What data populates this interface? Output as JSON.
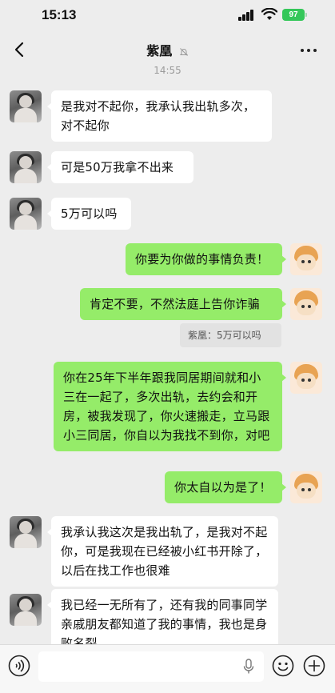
{
  "status_bar": {
    "time": "15:13",
    "battery": "97"
  },
  "header": {
    "title": "紫凰",
    "back_icon": "chevron-left-icon",
    "mute_icon": "bell-slash-icon",
    "more_icon": "more-dots-icon"
  },
  "chat": {
    "timestamp": "14:55",
    "messages": [
      {
        "side": "left",
        "text": "是我对不起你，我承认我出轨多次，对不起你"
      },
      {
        "side": "left",
        "text": "可是50万我拿不出来"
      },
      {
        "side": "left",
        "text": "5万可以吗"
      },
      {
        "side": "right",
        "text": "你要为你做的事情负责！"
      },
      {
        "side": "right",
        "text": "肯定不要，不然法庭上告你诈骗"
      },
      {
        "side": "right",
        "text": "你在25年下半年跟我同居期间就和小三在一起了，多次出轨，去约会和开房，被我发现了，你火速搬走，立马跟小三同居，你自以为我找不到你，对吧"
      },
      {
        "side": "right",
        "text": "你太自以为是了！"
      },
      {
        "side": "left",
        "text": "我承认我这次是我出轨了，是我对不起你，可是我现在已经被小红书开除了，以后在找工作也很难"
      },
      {
        "side": "left",
        "text": "我已经一无所有了，还有我的同事同学亲戚朋友都知道了我的事情，我也是身败名裂"
      }
    ],
    "quote": "紫凰：5万可以吗"
  },
  "input_bar": {
    "placeholder": "",
    "voice_icon": "voice-icon",
    "mic_icon": "microphone-icon",
    "emoji_icon": "emoji-icon",
    "plus_icon": "plus-icon"
  },
  "colors": {
    "background": "#ededed",
    "outgoing_bubble": "#95ec69",
    "incoming_bubble": "#ffffff",
    "battery": "#34c759"
  }
}
